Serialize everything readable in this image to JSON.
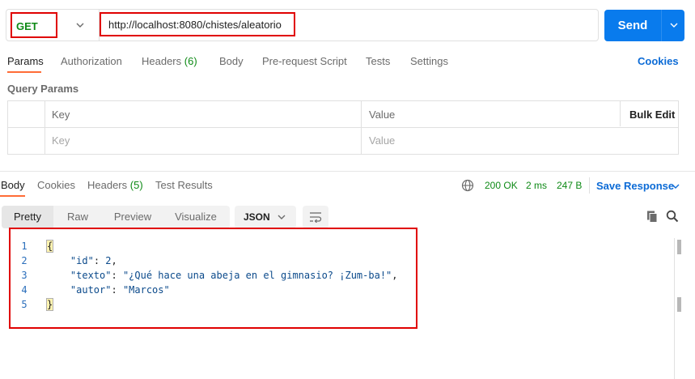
{
  "request": {
    "method": "GET",
    "url": "http://localhost:8080/chistes/aleatorio",
    "send_label": "Send"
  },
  "request_tabs": {
    "params": "Params",
    "authorization": "Authorization",
    "headers": "Headers",
    "headers_count": "(6)",
    "body": "Body",
    "prerequest": "Pre-request Script",
    "tests": "Tests",
    "settings": "Settings",
    "cookies": "Cookies"
  },
  "query_params": {
    "title": "Query Params",
    "col_key": "Key",
    "col_value": "Value",
    "bulk_edit": "Bulk Edit",
    "key_placeholder": "Key",
    "value_placeholder": "Value"
  },
  "response_tabs": {
    "body": "Body",
    "cookies": "Cookies",
    "headers": "Headers",
    "headers_count": "(5)",
    "test_results": "Test Results"
  },
  "status": {
    "code": "200 OK",
    "time": "2 ms",
    "size": "247 B",
    "save_response": "Save Response"
  },
  "view": {
    "pretty": "Pretty",
    "raw": "Raw",
    "preview": "Preview",
    "visualize": "Visualize",
    "format": "JSON"
  },
  "code": {
    "line_numbers": [
      "1",
      "2",
      "3",
      "4",
      "5"
    ],
    "open_brace": "{",
    "close_brace": "}",
    "fields": [
      {
        "key": "\"id\"",
        "value": "2",
        "comma": ","
      },
      {
        "key": "\"texto\"",
        "value": "\"¿Qué hace una abeja en el gimnasio? ¡Zum-ba!\"",
        "comma": ","
      },
      {
        "key": "\"autor\"",
        "value": "\"Marcos\"",
        "comma": ""
      }
    ]
  },
  "colors": {
    "accent_orange": "#ff6c37",
    "send_blue": "#097bed",
    "method_green": "#0e8a16",
    "highlight_red": "#e00000"
  },
  "icons": [
    "chevron-down-icon",
    "globe-icon",
    "wrap-lines-icon",
    "copy-icon",
    "search-icon"
  ]
}
